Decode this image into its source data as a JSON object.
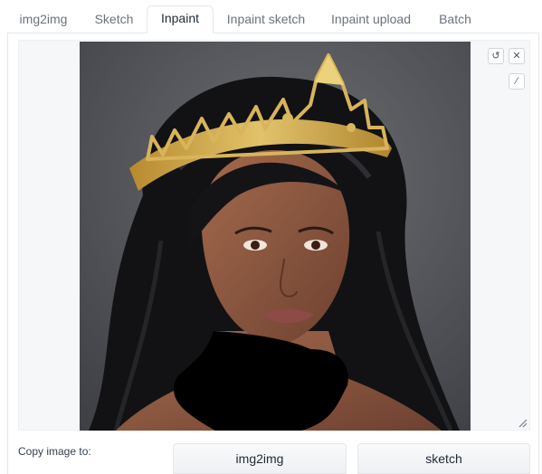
{
  "tabs": [
    {
      "label": "img2img",
      "active": false
    },
    {
      "label": "Sketch",
      "active": false
    },
    {
      "label": "Inpaint",
      "active": true
    },
    {
      "label": "Inpaint sketch",
      "active": false
    },
    {
      "label": "Inpaint upload",
      "active": false
    },
    {
      "label": "Batch",
      "active": false
    }
  ],
  "canvas": {
    "controls": {
      "undo_icon": "undo-icon",
      "close_icon": "close-icon",
      "brush_icon": "brush-icon",
      "undo_glyph": "↺",
      "close_glyph": "✕",
      "brush_glyph": "⁄"
    },
    "image_description_colors": {
      "background": "#54565b",
      "hair": "#141416",
      "skin": "#8a5a44",
      "crown": "#c9a24a",
      "mask": "#000000"
    }
  },
  "copy": {
    "label": "Copy image to:",
    "buttons": [
      "img2img",
      "sketch"
    ]
  }
}
